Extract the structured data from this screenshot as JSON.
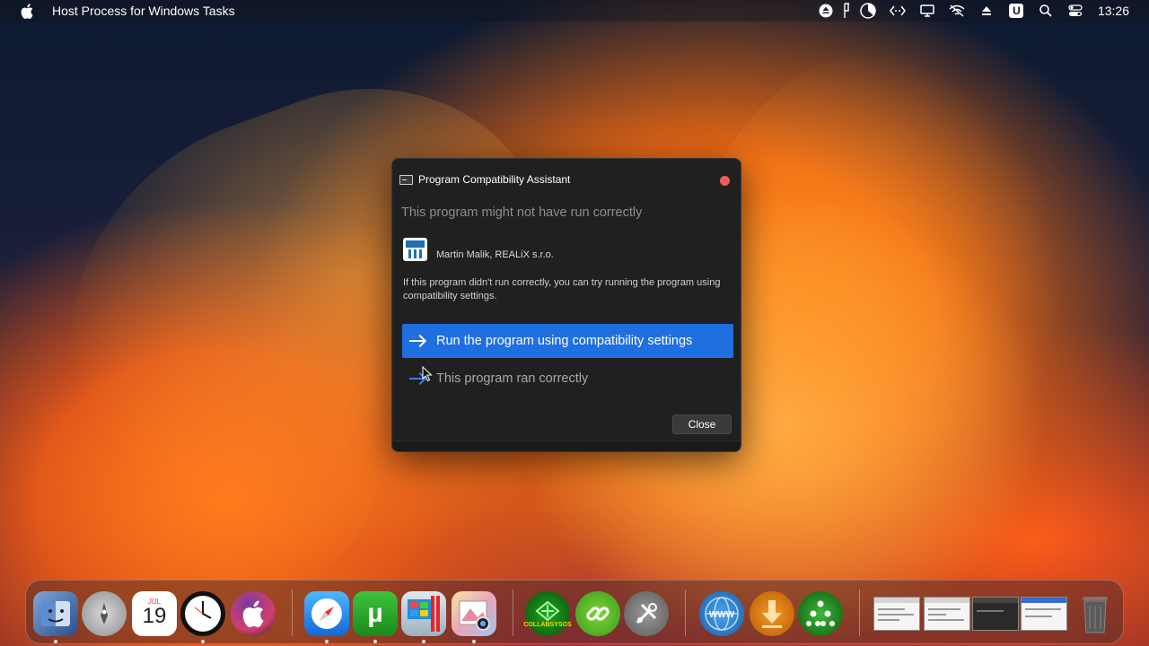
{
  "menubar": {
    "app_title": "Host Process for Windows Tasks",
    "clock": "13:26",
    "status_icons": [
      "eject-icon",
      "pinnacle-icon",
      "pie-chart-icon",
      "code-icon",
      "display-icon",
      "wifi-off-icon",
      "eject-triangle-icon",
      "u-badge-icon",
      "search-icon",
      "control-center-icon"
    ],
    "u_badge": "U"
  },
  "dialog": {
    "title": "Program Compatibility Assistant",
    "heading": "This program might not have run correctly",
    "publisher": "Martin Malik, REALiX s.r.o.",
    "description": "If this program didn't run correctly, you can try running the program using compatibility settings.",
    "run_option": "Run the program using compatibility settings",
    "ran_option": "This program ran correctly",
    "close_label": "Close"
  },
  "dock": {
    "calendar_month": "JUL",
    "calendar_day": "19",
    "collab_label": "COLLABSYSOS",
    "www_label": "WWW",
    "torrent_label": "µ",
    "apps": [
      "finder",
      "launchpad",
      "calendar",
      "clock",
      "apple-tv",
      "safari",
      "utorrent",
      "parallels",
      "preview",
      "collabsysos",
      "link",
      "tools",
      "www",
      "downloader",
      "network"
    ]
  },
  "colors": {
    "accent_blue": "#1f6fe0",
    "close_red": "#ec5f5a",
    "dialog_bg": "#202020"
  }
}
